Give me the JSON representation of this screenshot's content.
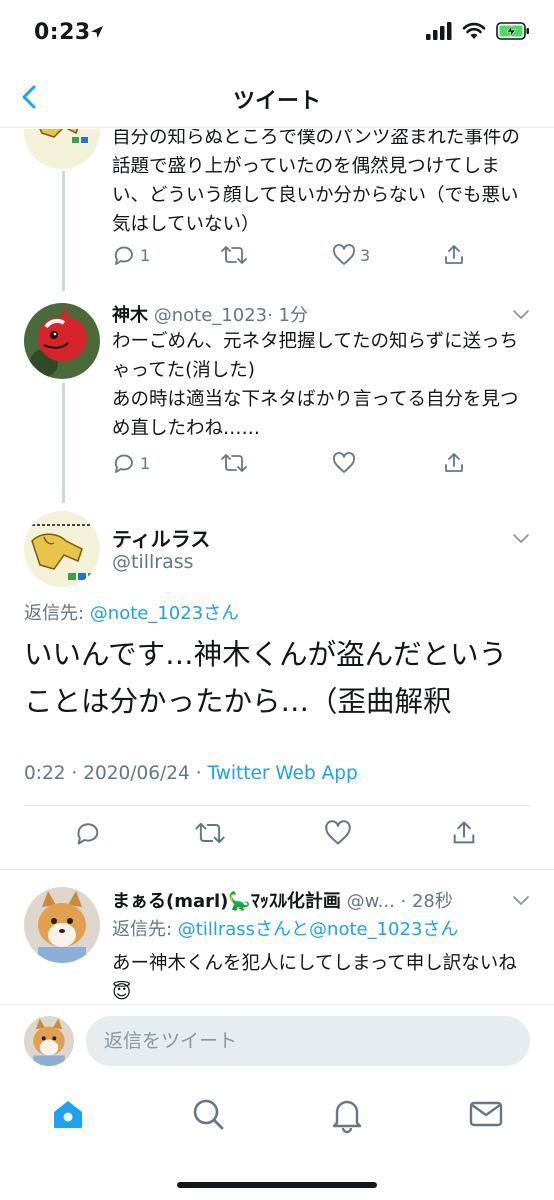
{
  "status_bar": {
    "time": "0:23",
    "battery_color": "#4cd964"
  },
  "nav": {
    "title": "ツイート"
  },
  "tweets": [
    {
      "text": "自分の知らぬところで僕のパンツ盗まれた事件の話題で盛り上がっていたのを偶然見つけてしまい、どういう顔して良いか分からない（でも悪い気はしていない）",
      "reply_count": "1",
      "like_count": "3"
    },
    {
      "name": "神木",
      "handle": "@note_1023",
      "time": "· 1分",
      "text": "わーごめん、元ネタ把握してたの知らずに送っちゃってた(消した)\nあの時は適当な下ネタばかり言ってる自分を見つめ直したわね……",
      "reply_count": "1",
      "like_count": ""
    }
  ],
  "main_tweet": {
    "name": "ティルラス",
    "handle": "@tillrass",
    "reply_prefix": "返信先: ",
    "reply_target": "@note_1023さん",
    "text": "いいんです…神木くんが盗んだということは分かったから…（歪曲解釈",
    "timestamp": "0:22 · 2020/06/24 · ",
    "source": "Twitter Web App"
  },
  "reply_tweet": {
    "name": "まぁる(marl)🦕ﾏｯｽﾙ化計画",
    "handle": "@w...",
    "time": "· 28秒",
    "reply_prefix": "返信先: ",
    "reply_targets": "@tillrassさんと@note_1023さん",
    "text": "あー神木くんを犯人にしてしまって申し訳ないね😇"
  },
  "reply_bar": {
    "placeholder": "返信をツイート"
  },
  "tabs": [
    "home-icon",
    "search-icon",
    "notifications-icon",
    "messages-icon"
  ],
  "colors": {
    "accent": "#1da1f2",
    "muted": "#657786",
    "divider": "#e6ecf0"
  }
}
